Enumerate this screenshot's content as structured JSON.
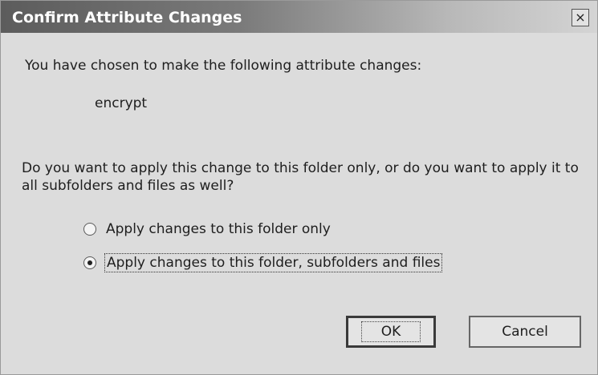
{
  "window": {
    "title": "Confirm Attribute Changes",
    "close_label": "×"
  },
  "content": {
    "heading": "You have chosen to make the following attribute changes:",
    "attribute": "encrypt",
    "question": "Do you want to apply this change to this folder only, or do you want to apply it to all subfolders and files as well?"
  },
  "options": [
    {
      "label": "Apply changes to this folder only",
      "selected": false
    },
    {
      "label": "Apply changes to this folder, subfolders and files",
      "selected": true
    }
  ],
  "buttons": {
    "ok": "OK",
    "cancel": "Cancel"
  }
}
